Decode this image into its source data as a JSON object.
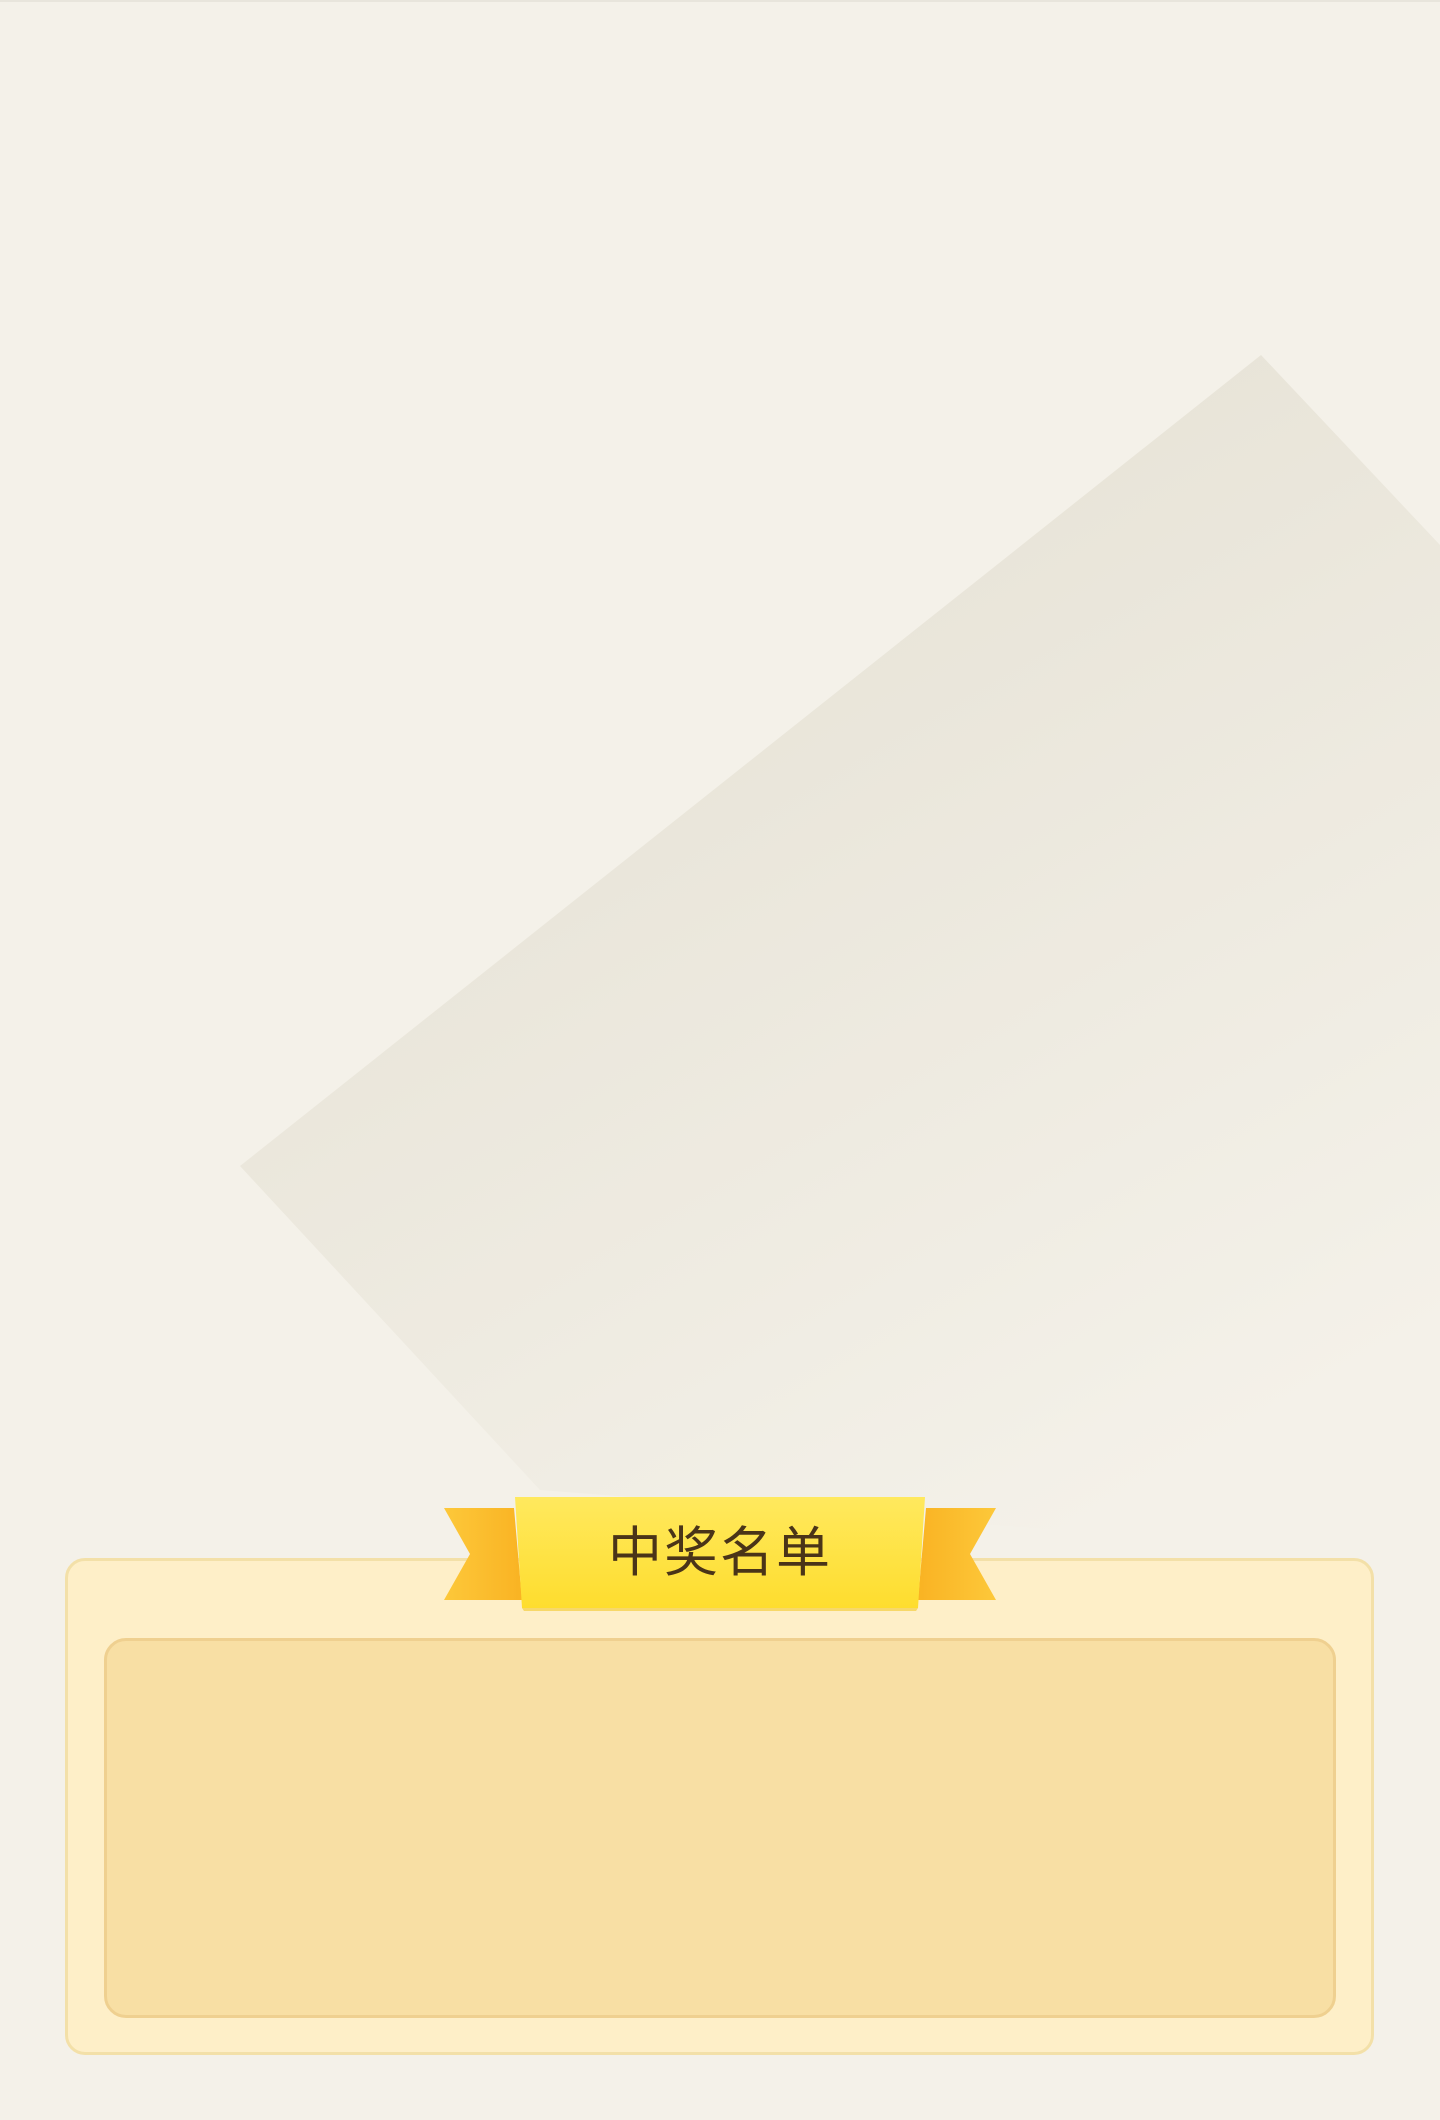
{
  "award_list": {
    "title": "中奖名单",
    "entries": []
  }
}
